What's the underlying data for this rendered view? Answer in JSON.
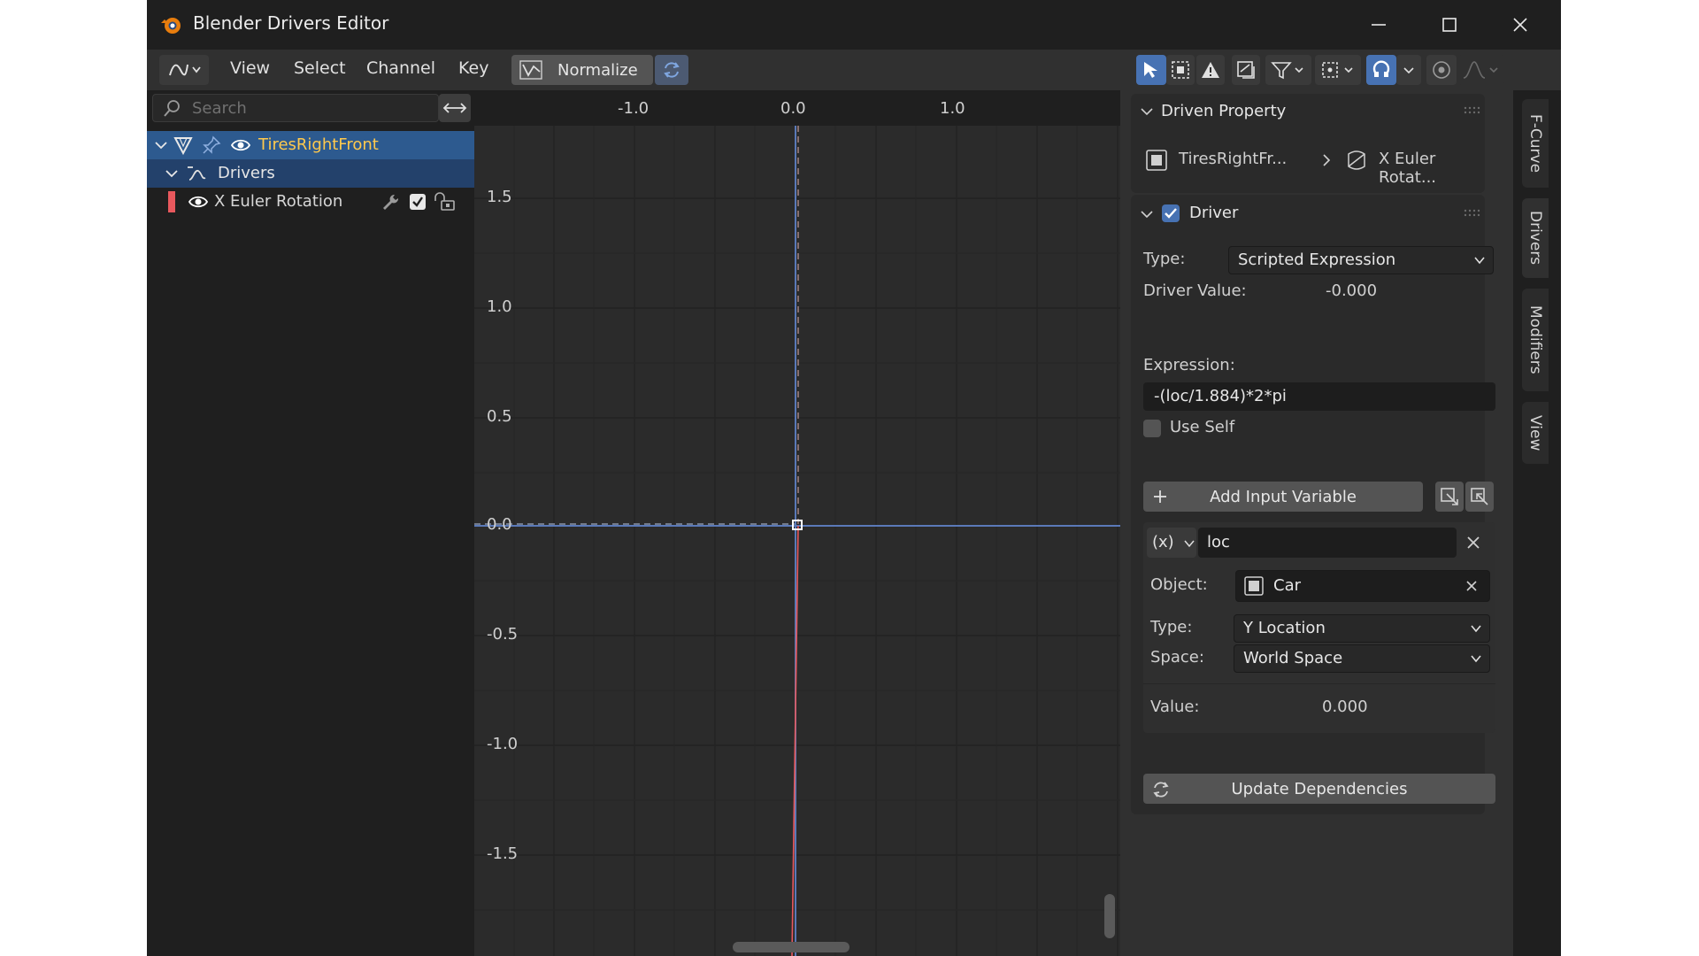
{
  "window": {
    "title": "Blender Drivers Editor"
  },
  "header": {
    "menus": [
      "View",
      "Select",
      "Channel",
      "Key"
    ],
    "normalize_label": "Normalize"
  },
  "channels": {
    "search_placeholder": "Search",
    "object_name": "TiresRightFront",
    "drivers_label": "Drivers",
    "fcurve_name": "X Euler Rotation",
    "fcurve_color": "#e8585d"
  },
  "graph": {
    "x_ticks": [
      "-1.0",
      "0.0",
      "1.0"
    ],
    "y_ticks": [
      "1.5",
      "1.0",
      "0.5",
      "0.0",
      "-0.5",
      "-1.0",
      "-1.5"
    ]
  },
  "sidebar": {
    "driven_property": {
      "title": "Driven Property",
      "object": "TiresRightFr...",
      "property": "X Euler Rotat..."
    },
    "driver": {
      "title": "Driver",
      "type_label": "Type:",
      "type_value": "Scripted Expression",
      "value_label": "Driver Value:",
      "value": "-0.000",
      "expression_label": "Expression:",
      "expression": "-(loc/1.884)*2*pi",
      "use_self_label": "Use Self",
      "add_variable_label": "Add Input Variable",
      "variable": {
        "type_symbol": "(x)",
        "name": "loc",
        "object_label": "Object:",
        "object_value": "Car",
        "type_label": "Type:",
        "type_value": "Y Location",
        "space_label": "Space:",
        "space_value": "World Space",
        "value_label": "Value:",
        "value": "0.000"
      },
      "update_label": "Update Dependencies"
    }
  },
  "tabs": [
    "F-Curve",
    "Drivers",
    "Modifiers",
    "View"
  ],
  "colors": {
    "accent": "#4772b3",
    "selected_text": "#ffc94d"
  }
}
